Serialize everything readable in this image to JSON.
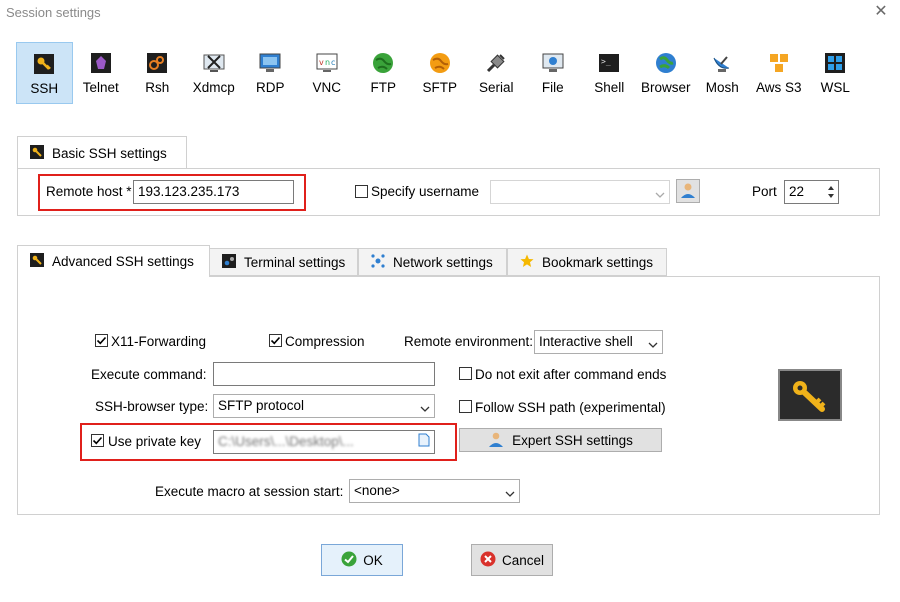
{
  "window": {
    "title": "Session settings",
    "close_glyph": "✕"
  },
  "session_types": [
    {
      "label": "SSH",
      "icon": "key-icon",
      "active": true
    },
    {
      "label": "Telnet",
      "icon": "telnet-icon"
    },
    {
      "label": "Rsh",
      "icon": "rsh-icon"
    },
    {
      "label": "Xdmcp",
      "icon": "xdmcp-icon"
    },
    {
      "label": "RDP",
      "icon": "rdp-monitor-icon"
    },
    {
      "label": "VNC",
      "icon": "vnc-icon"
    },
    {
      "label": "FTP",
      "icon": "ftp-globe-icon"
    },
    {
      "label": "SFTP",
      "icon": "sftp-globe-icon"
    },
    {
      "label": "Serial",
      "icon": "serial-plug-icon"
    },
    {
      "label": "File",
      "icon": "file-monitor-icon"
    },
    {
      "label": "Shell",
      "icon": "shell-terminal-icon"
    },
    {
      "label": "Browser",
      "icon": "browser-globe-icon"
    },
    {
      "label": "Mosh",
      "icon": "satellite-dish-icon"
    },
    {
      "label": "Aws S3",
      "icon": "aws-cubes-icon"
    },
    {
      "label": "WSL",
      "icon": "windows-logo-icon"
    }
  ],
  "basic": {
    "tab_label": "Basic SSH settings",
    "remote_host_label": "Remote host *",
    "remote_host_value": "193.123.235.173",
    "specify_username_label": "Specify username",
    "username_value": "",
    "port_label": "Port",
    "port_value": "22"
  },
  "tabs": [
    {
      "label": "Advanced SSH settings",
      "icon": "key-icon",
      "selected": true
    },
    {
      "label": "Terminal settings",
      "icon": "terminal-icon"
    },
    {
      "label": "Network settings",
      "icon": "network-icon"
    },
    {
      "label": "Bookmark settings",
      "icon": "star-icon"
    }
  ],
  "advanced": {
    "x11_label": "X11-Forwarding",
    "x11_checked": true,
    "compression_label": "Compression",
    "compression_checked": true,
    "remote_env_label": "Remote environment:",
    "remote_env_value": "Interactive shell",
    "execute_command_label": "Execute command:",
    "execute_command_value": "",
    "no_exit_label": "Do not exit after command ends",
    "no_exit_checked": false,
    "browser_type_label": "SSH-browser type:",
    "browser_type_value": "SFTP protocol",
    "follow_path_label": "Follow SSH path (experimental)",
    "follow_path_checked": false,
    "private_key_label": "Use private key",
    "private_key_checked": true,
    "private_key_value": "C:\\Users\\...\\Desktop\\...",
    "expert_label": "Expert SSH settings",
    "macro_label": "Execute macro at session start:",
    "macro_value": "<none>"
  },
  "buttons": {
    "ok": "OK",
    "cancel": "Cancel"
  },
  "colors": {
    "highlight": "#e0201b",
    "active_tab_bg": "#cce4f7",
    "key_gold": "#f0b21a"
  }
}
